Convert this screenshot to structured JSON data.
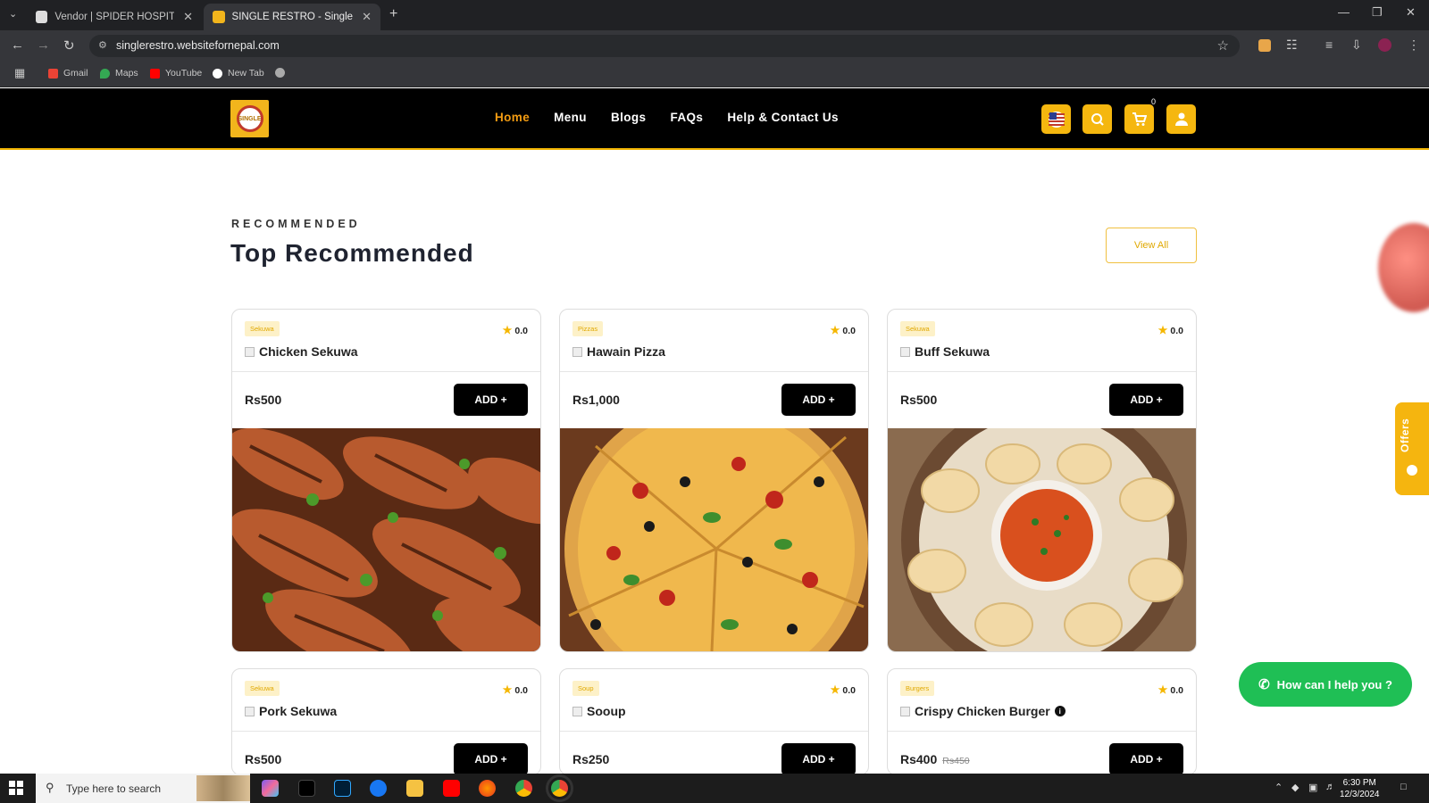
{
  "browser": {
    "tabs": [
      {
        "title": "Vendor | SPIDER HOSPITALITY F",
        "active": false
      },
      {
        "title": "SINGLE RESTRO - Single Restau",
        "active": true
      }
    ],
    "new_tab_icon": "plus-icon",
    "url": "singlerestro.websitefornepal.com",
    "bookmarks": [
      "Gmail",
      "Maps",
      "YouTube",
      "New Tab"
    ]
  },
  "site": {
    "brand_color": "#f5b70f",
    "header_bg": "#000000",
    "logo_text": "SINGLE",
    "nav": [
      {
        "label": "Home",
        "active": true
      },
      {
        "label": "Menu",
        "active": false
      },
      {
        "label": "Blogs",
        "active": false
      },
      {
        "label": "FAQs",
        "active": false
      },
      {
        "label": "Help & Contact Us",
        "active": false
      }
    ],
    "header_icons": [
      "us-flag-icon",
      "search-icon",
      "cart-icon",
      "user-icon"
    ],
    "cart_count": "0"
  },
  "section": {
    "eyebrow": "RECOMMENDED",
    "title": "Top Recommended",
    "view_all": "View All"
  },
  "products": [
    {
      "category": "Sekuwa",
      "rating": "0.0",
      "name": "Chicken Sekuwa",
      "price": "Rs500",
      "old_price": "",
      "add_label": "ADD",
      "image": "grilled-chicken"
    },
    {
      "category": "Pizzas",
      "rating": "0.0",
      "name": "Hawain Pizza",
      "price": "Rs1,000",
      "old_price": "",
      "add_label": "ADD",
      "image": "pizza"
    },
    {
      "category": "Sekuwa",
      "rating": "0.0",
      "name": "Buff Sekuwa",
      "price": "Rs500",
      "old_price": "",
      "add_label": "ADD",
      "image": "momo-plate"
    },
    {
      "category": "Sekuwa",
      "rating": "0.0",
      "name": "Pork Sekuwa",
      "price": "Rs500",
      "old_price": "",
      "add_label": "ADD"
    },
    {
      "category": "Soup",
      "rating": "0.0",
      "name": "Sooup",
      "price": "Rs250",
      "old_price": "",
      "add_label": "ADD"
    },
    {
      "category": "Burgers",
      "rating": "0.0",
      "name": "Crispy Chicken Burger",
      "price": "Rs400",
      "old_price": "Rs450",
      "add_label": "ADD",
      "info_icon": true
    }
  ],
  "offers_tab": {
    "label": "Offers"
  },
  "help_button": {
    "label": "How can I help you ?",
    "color": "#1fbf55"
  },
  "taskbar": {
    "search_placeholder": "Type here to search",
    "time": "6:30 PM",
    "date": "12/3/2024"
  }
}
